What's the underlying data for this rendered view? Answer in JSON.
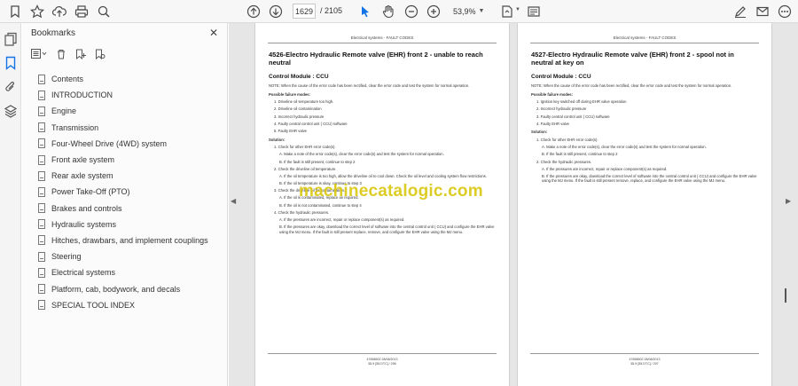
{
  "toolbar": {
    "page_current": "1629",
    "page_total": "/ 2105",
    "zoom": "53,9%"
  },
  "bookmarks": {
    "title": "Bookmarks",
    "items": [
      {
        "label": "Contents"
      },
      {
        "label": "INTRODUCTION"
      },
      {
        "label": "Engine"
      },
      {
        "label": "Transmission"
      },
      {
        "label": "Four-Wheel Drive (4WD) system"
      },
      {
        "label": "Front axle system"
      },
      {
        "label": "Rear axle system"
      },
      {
        "label": "Power Take-Off (PTO)"
      },
      {
        "label": "Brakes and controls"
      },
      {
        "label": "Hydraulic systems"
      },
      {
        "label": "Hitches, drawbars, and implement couplings"
      },
      {
        "label": "Steering"
      },
      {
        "label": "Electrical systems"
      },
      {
        "label": "Platform, cab, bodywork, and decals"
      },
      {
        "label": "SPECIAL TOOL INDEX"
      }
    ]
  },
  "left_page": {
    "header": "Electrical systems - FAULT CODES",
    "title": "4526-Electro Hydraulic Remote valve (EHR) front 2 - unable to reach neutral",
    "module": "Control Module : CCU",
    "note": "NOTE: When the cause of the error code has been rectified, clear the error code and test the system for normal operation.",
    "failure_heading": "Possible failure modes:",
    "failures": [
      "1.  Driveline oil temperature too high.",
      "2.  Driveline oil contamination",
      "3.  Incorrect hydraulic pressure",
      "4.  Faulty central control unit ( CCU) software",
      "5.  Faulty EHR valve"
    ],
    "solution_heading": "Solution:",
    "steps": [
      {
        "text": "1.  Check for other EHR error code(s).",
        "level": 1
      },
      {
        "text": "A.  Make a note of the error code(s), clear the error code(s) and test the system for normal operation.",
        "level": 2
      },
      {
        "text": "B.  If the fault is still present, continue to step 2",
        "level": 2
      },
      {
        "text": "2.  Check the driveline oil temperature.",
        "level": 1
      },
      {
        "text": "A.  If the oil temperature is too high, allow the driveline oil to cool down. Check the oil level and cooling system flow restrictions.",
        "level": 2
      },
      {
        "text": "B.  If the oil temperature is okay, continue to step 3",
        "level": 2
      },
      {
        "text": "3.  Check the driveline oil for contamination.",
        "level": 1
      },
      {
        "text": "A.  If the oil is contaminated, replace as required.",
        "level": 2
      },
      {
        "text": "B.  If the oil is not contaminated, continue to step 4",
        "level": 2
      },
      {
        "text": "4.  Check the hydraulic pressures.",
        "level": 1
      },
      {
        "text": "A.  If the pressures are incorrect, repair or replace component(s) as required.",
        "level": 2
      },
      {
        "text": "B.  If the pressures are okay, download the correct level of software into the central control unit ( CCU) and configure the EHR valve using the MJ menu. If the fault is still present replace, remove, and configure the EHR valve using the MJ menu.",
        "level": 2
      }
    ],
    "footer_code": "47658502 28/08/2013",
    "footer_page": "55.9 [55.DTC] / 296"
  },
  "right_page": {
    "header": "Electrical systems - FAULT CODES",
    "title": "4527-Electro Hydraulic Remote valve (EHR) front 2 - spool not in neutral at key on",
    "module": "Control Module : CCU",
    "note": "NOTE: When the cause of the error code has been rectified, clear the error code and test the system for normal operation.",
    "failure_heading": "Possible failure modes:",
    "failures": [
      "1.  Ignition key switched off during EHR valve operation",
      "2.  Incorrect hydraulic pressure",
      "3.  Faulty central control unit ( CCU) software",
      "4.  Faulty EHR valve"
    ],
    "solution_heading": "Solution:",
    "steps": [
      {
        "text": "1.  Check for other EHR error code(s).",
        "level": 1
      },
      {
        "text": "A.  Make a note of the error code(s), clear the error code(s) and test the system for normal operation.",
        "level": 2
      },
      {
        "text": "B.  If the fault is still present, continue to step 2",
        "level": 2
      },
      {
        "text": "2.  Check the hydraulic pressures.",
        "level": 1
      },
      {
        "text": "A.  If the pressures are incorrect, repair or replace component(s) as required.",
        "level": 2
      },
      {
        "text": "B.  If the pressures are okay, download the correct level of software into the central control unit ( CCU) and configure the EHR valve using the MJ menu. If the fault is still present remove, replace, and configure the EHR valve using the MJ menu.",
        "level": 2
      }
    ],
    "footer_code": "47658502 28/08/2013",
    "footer_page": "55.9 [55.DTC] / 297"
  },
  "watermark": "machinecatalogic.com"
}
